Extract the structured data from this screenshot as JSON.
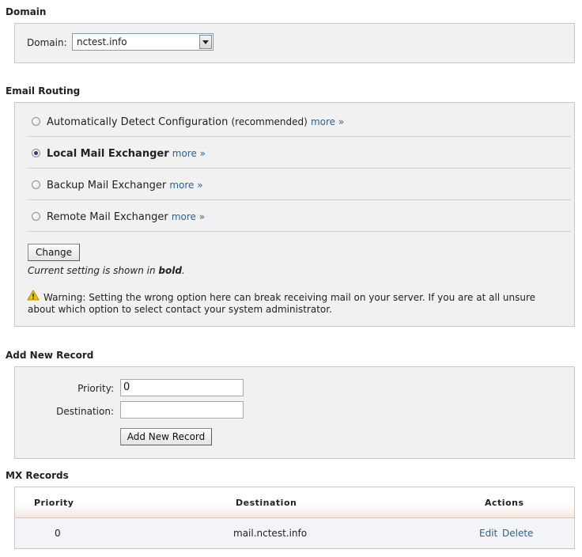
{
  "domain_section": {
    "title": "Domain",
    "label": "Domain:",
    "selected": "nctest.info"
  },
  "routing": {
    "title": "Email Routing",
    "options": [
      {
        "label": "Automatically Detect Configuration",
        "suffix": "(recommended)",
        "more": "more »",
        "checked": false
      },
      {
        "label": "Local Mail Exchanger",
        "more": "more »",
        "checked": true
      },
      {
        "label": "Backup Mail Exchanger",
        "more": "more »",
        "checked": false
      },
      {
        "label": "Remote Mail Exchanger",
        "more": "more »",
        "checked": false
      }
    ],
    "change_button": "Change",
    "current_prefix": "Current setting is shown in",
    "current_bold": "bold",
    "current_suffix": ".",
    "warning": "Warning: Setting the wrong option here can break receiving mail on your server. If you are at all unsure about which option to select contact your system administrator."
  },
  "add_record": {
    "title": "Add New Record",
    "priority_label": "Priority:",
    "priority_value": "0",
    "destination_label": "Destination:",
    "destination_value": "",
    "submit": "Add New Record"
  },
  "mx_records": {
    "title": "MX Records",
    "columns": {
      "priority": "Priority",
      "destination": "Destination",
      "actions": "Actions"
    },
    "rows": [
      {
        "priority": "0",
        "destination": "mail.nctest.info",
        "edit": "Edit",
        "delete": "Delete"
      }
    ]
  },
  "colors": {
    "link": "#2a6496",
    "panel_bg": "#f1f1f1",
    "warning_icon": "#f2c200"
  }
}
